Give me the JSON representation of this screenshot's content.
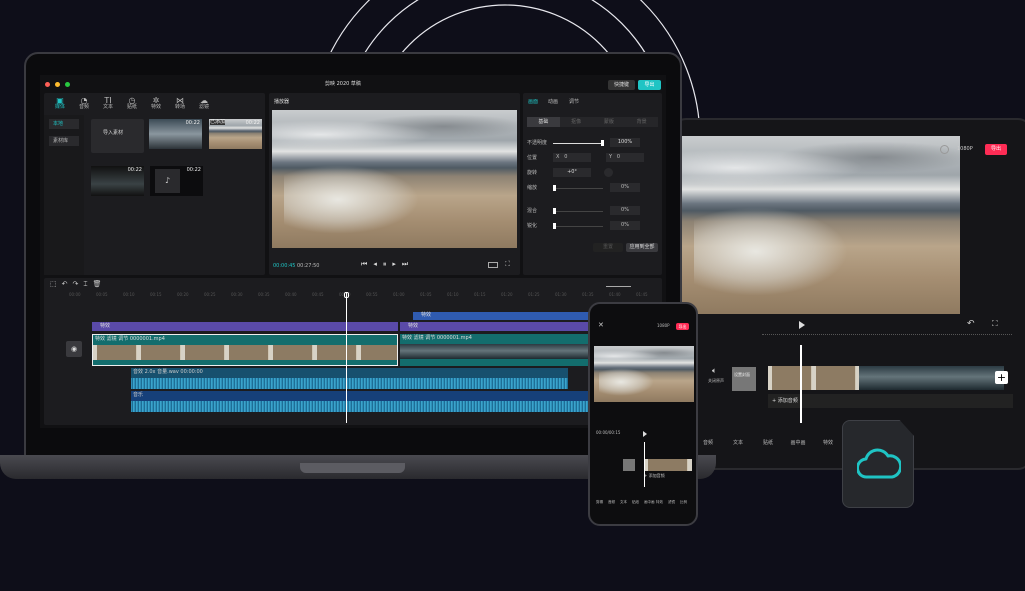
{
  "laptop": {
    "window_title": "剪映 2020 草稿",
    "shortcut_label": "快捷键",
    "export_label": "导出",
    "media_tabs": [
      {
        "label": "媒体",
        "icon": "media-icon"
      },
      {
        "label": "音频",
        "icon": "audio-icon"
      },
      {
        "label": "文本",
        "icon": "text-icon"
      },
      {
        "label": "贴纸",
        "icon": "sticker-icon"
      },
      {
        "label": "特效",
        "icon": "effects-icon"
      },
      {
        "label": "转场",
        "icon": "transition-icon"
      },
      {
        "label": "滤镜",
        "icon": "filter-icon"
      }
    ],
    "media_sidebar": [
      "本地",
      "素材库"
    ],
    "import_label": "导入素材",
    "media_items": [
      {
        "duration": "00:22"
      },
      {
        "duration": "00:22",
        "badge": "已添加"
      },
      {
        "duration": "00:22"
      },
      {
        "duration": "00:22"
      }
    ],
    "player_title": "播放器",
    "current_time": "00:00:45",
    "total_time": "00:27:50",
    "props_tabs": [
      "画面",
      "动画",
      "调节"
    ],
    "props_subtabs": [
      "基础",
      "抠像",
      "蒙版",
      "背景"
    ],
    "props": {
      "opacity_label": "不透明度",
      "opacity_value": "100%",
      "opacity_level": 1.0,
      "position_label": "位置",
      "x_label": "X",
      "x_value": "0",
      "y_label": "Y",
      "y_value": "0",
      "rotate_label": "旋转",
      "rotate_value": "+0°",
      "scale_label": "缩放",
      "scale_value": "0%",
      "blend_label": "混合",
      "blend_value": "0%",
      "sharpen_label": "锐化",
      "sharpen_value": "0%",
      "reset_label": "重置",
      "apply_all_label": "应用到全部"
    },
    "timeline": {
      "ruler": [
        "00:00",
        "00:05",
        "00:10",
        "00:15",
        "00:20",
        "00:25",
        "00:30",
        "00:35",
        "00:40",
        "00:45",
        "00:50",
        "00:55",
        "01:00",
        "01:05",
        "01:10",
        "01:15",
        "01:20",
        "01:25",
        "01:30",
        "01:35",
        "01:40",
        "01:45"
      ],
      "effect_track_label": "特效",
      "text_track_label": "特效",
      "clip_tags": [
        "特效",
        "滤镜",
        "调节"
      ],
      "clip_name": "0000001.mp4",
      "audio1_tags": [
        "音效 2.0x",
        "音量.wav",
        "00:00:00"
      ],
      "audio2_label": "音乐"
    }
  },
  "tablet": {
    "resolution": "1080P",
    "export_label": "导出",
    "cover_label": "设置封面",
    "mute_label": "关闭原声",
    "add_audio_label": "+ 添加音频",
    "toolbar": [
      "音频",
      "文本",
      "贴纸",
      "画中画",
      "特效",
      "滤镜",
      "调节"
    ]
  },
  "phone": {
    "resolution": "1080P",
    "export_label": "导出",
    "time": "00:00/00:15",
    "add_audio_label": "+ 添加音频",
    "toolbar": [
      "剪辑",
      "音频",
      "文本",
      "贴纸",
      "画中画",
      "特效",
      "滤镜",
      "比例"
    ]
  },
  "colors": {
    "accent": "#1fc4c4",
    "export_pink": "#fe2c55",
    "purple": "#5a4aa8",
    "blue": "#2f5bb0"
  }
}
